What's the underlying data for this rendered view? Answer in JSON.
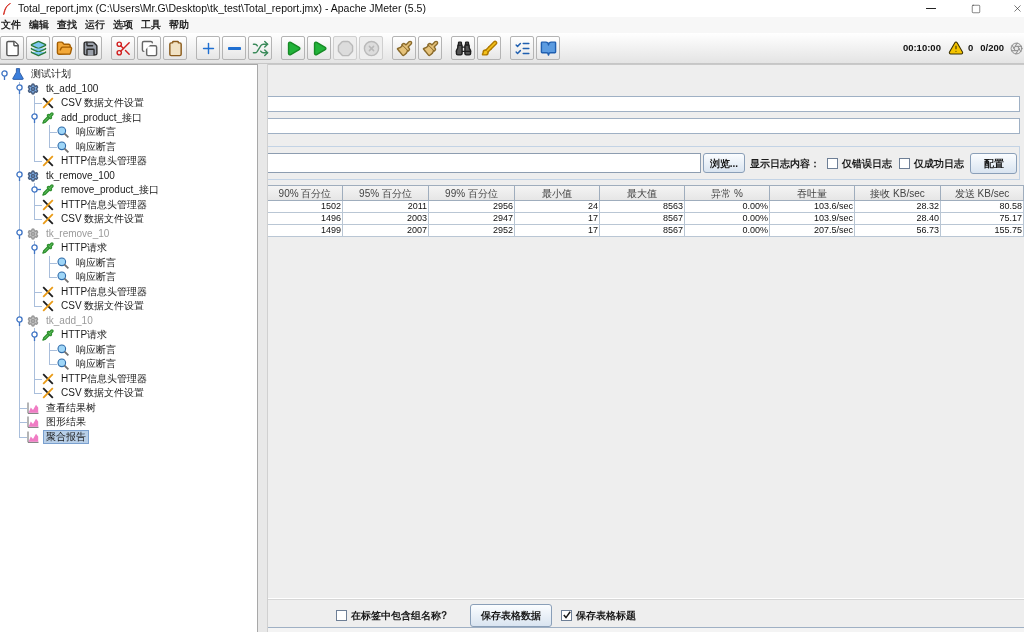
{
  "window": {
    "title": "Total_report.jmx (C:\\Users\\Mr.G\\Desktop\\tk_test\\Total_report.jmx) - Apache JMeter (5.5)"
  },
  "menu": [
    "文件",
    "编辑",
    "查找",
    "运行",
    "选项",
    "工具",
    "帮助"
  ],
  "toolbar": {
    "groups": [
      {
        "buttons": [
          {
            "disabled": false
          },
          {
            "disabled": false
          },
          {
            "disabled": false
          },
          {
            "disabled": false
          }
        ]
      },
      {
        "buttons": [
          {
            "disabled": false
          },
          {
            "disabled": false
          },
          {
            "disabled": false
          }
        ]
      },
      {
        "buttons": [
          {
            "disabled": false
          },
          {
            "disabled": false
          },
          {
            "disabled": false
          }
        ]
      },
      {
        "buttons": [
          {
            "disabled": false
          },
          {
            "disabled": false
          },
          {
            "disabled": true
          },
          {
            "disabled": true
          }
        ]
      },
      {
        "buttons": [
          {
            "disabled": false
          },
          {
            "disabled": false
          }
        ]
      },
      {
        "buttons": [
          {
            "disabled": false
          },
          {
            "disabled": false
          }
        ]
      },
      {
        "buttons": [
          {
            "disabled": false
          },
          {
            "disabled": false
          }
        ]
      }
    ],
    "status": {
      "elapsed_time": "00:10:00",
      "error_count": "0",
      "active_threads": "0/200"
    }
  },
  "tree": [
    {
      "label": "测试计划",
      "kind": "plan",
      "disabled": false,
      "selected": false,
      "expanded": true,
      "children": [
        {
          "label": "tk_add_100",
          "kind": "thread-group",
          "disabled": false,
          "selected": false,
          "expanded": true,
          "children": [
            {
              "label": "CSV 数据文件设置",
              "kind": "config",
              "disabled": false,
              "selected": false
            },
            {
              "label": "add_product_接口",
              "kind": "sampler",
              "disabled": false,
              "selected": false,
              "expanded": true,
              "children": [
                {
                  "label": "响应断言",
                  "kind": "assertion",
                  "disabled": false,
                  "selected": false
                },
                {
                  "label": "响应断言",
                  "kind": "assertion",
                  "disabled": false,
                  "selected": false
                }
              ]
            },
            {
              "label": "HTTP信息头管理器",
              "kind": "config",
              "disabled": false,
              "selected": false
            }
          ]
        },
        {
          "label": "tk_remove_100",
          "kind": "thread-group",
          "disabled": false,
          "selected": false,
          "expanded": true,
          "children": [
            {
              "label": "remove_product_接口",
              "kind": "sampler",
              "disabled": false,
              "selected": false,
              "expanded": false
            },
            {
              "label": "HTTP信息头管理器",
              "kind": "config",
              "disabled": false,
              "selected": false
            },
            {
              "label": "CSV 数据文件设置",
              "kind": "config",
              "disabled": false,
              "selected": false
            }
          ]
        },
        {
          "label": "tk_remove_10",
          "kind": "thread-group",
          "disabled": true,
          "selected": false,
          "expanded": true,
          "children": [
            {
              "label": "HTTP请求",
              "kind": "sampler",
              "disabled": false,
              "selected": false,
              "expanded": true,
              "children": [
                {
                  "label": "响应断言",
                  "kind": "assertion",
                  "disabled": false,
                  "selected": false
                },
                {
                  "label": "响应断言",
                  "kind": "assertion",
                  "disabled": false,
                  "selected": false
                }
              ]
            },
            {
              "label": "HTTP信息头管理器",
              "kind": "config",
              "disabled": false,
              "selected": false
            },
            {
              "label": "CSV 数据文件设置",
              "kind": "config",
              "disabled": false,
              "selected": false
            }
          ]
        },
        {
          "label": "tk_add_10",
          "kind": "thread-group",
          "disabled": true,
          "selected": false,
          "expanded": true,
          "children": [
            {
              "label": "HTTP请求",
              "kind": "sampler",
              "disabled": false,
              "selected": false,
              "expanded": true,
              "children": [
                {
                  "label": "响应断言",
                  "kind": "assertion",
                  "disabled": false,
                  "selected": false
                },
                {
                  "label": "响应断言",
                  "kind": "assertion",
                  "disabled": false,
                  "selected": false
                }
              ]
            },
            {
              "label": "HTTP信息头管理器",
              "kind": "config",
              "disabled": false,
              "selected": false
            },
            {
              "label": "CSV 数据文件设置",
              "kind": "config",
              "disabled": false,
              "selected": false
            }
          ]
        },
        {
          "label": "查看结果树",
          "kind": "listener",
          "disabled": false,
          "selected": false
        },
        {
          "label": "图形结果",
          "kind": "listener",
          "disabled": false,
          "selected": false
        },
        {
          "label": "聚合报告",
          "kind": "listener",
          "disabled": false,
          "selected": true
        }
      ]
    }
  ],
  "report": {
    "log_file": {
      "browse_button": "浏览...",
      "display_label": "显示日志内容：",
      "options": [
        {
          "label": "仅错误日志",
          "checked": false
        },
        {
          "label": "仅成功日志",
          "checked": false
        }
      ],
      "configure_button": "配置"
    },
    "table": {
      "columns": [
        "90% 百分位",
        "95% 百分位",
        "99% 百分位",
        "最小值",
        "最大值",
        "异常 %",
        "吞吐量",
        "接收 KB/sec",
        "发送 KB/sec"
      ],
      "rows": [
        [
          "1502",
          "2011",
          "2956",
          "24",
          "8563",
          "0.00%",
          "103.6/sec",
          "28.32",
          "80.58"
        ],
        [
          "1496",
          "2003",
          "2947",
          "17",
          "8567",
          "0.00%",
          "103.9/sec",
          "28.40",
          "75.17"
        ],
        [
          "1499",
          "2007",
          "2952",
          "17",
          "8567",
          "0.00%",
          "207.5/sec",
          "56.73",
          "155.75"
        ]
      ]
    },
    "footer": [
      {
        "kind": "checkbox",
        "label": "在标签中包含组名称?",
        "checked": false
      },
      {
        "kind": "button",
        "label": "保存表格数据"
      },
      {
        "kind": "checkbox",
        "label": "保存表格标题",
        "checked": true
      }
    ]
  }
}
